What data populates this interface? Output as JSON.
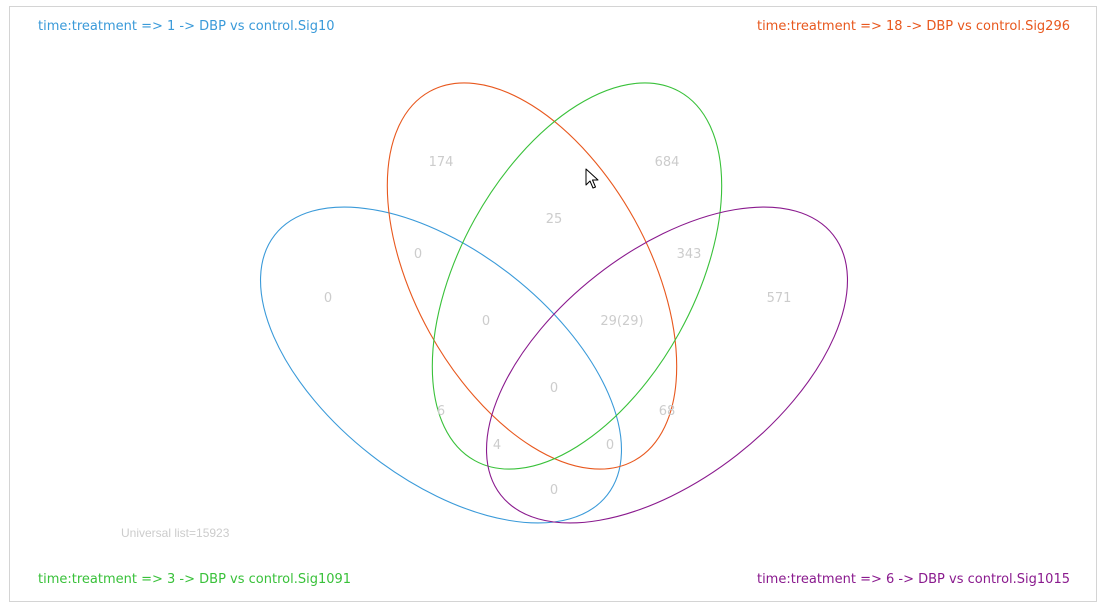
{
  "sets": [
    {
      "label": "time:treatment => 1 -> DBP vs control.Sig10",
      "color": "#3a9ad9"
    },
    {
      "label": "time:treatment => 18 -> DBP vs control.Sig296",
      "color": "#e8581e"
    },
    {
      "label": "time:treatment => 3 -> DBP vs control.Sig1091",
      "color": "#39c13a"
    },
    {
      "label": "time:treatment => 6 -> DBP vs control.Sig1015",
      "color": "#8a1a8e"
    }
  ],
  "universal": "Universal list=15923",
  "regions": {
    "only_18": "174",
    "only_3": "684",
    "r_18_3": "25",
    "r_1_18": "0",
    "r_3_6": "343",
    "only_1": "0",
    "only_6": "571",
    "r_1_18_3": "0",
    "r_18_3_6": "29(29)",
    "r_all": "0",
    "r_1_3": "6",
    "r_18_6": "68",
    "r_1_3_6": "4",
    "r_1_18_6": "0",
    "r_1_6": "0"
  }
}
